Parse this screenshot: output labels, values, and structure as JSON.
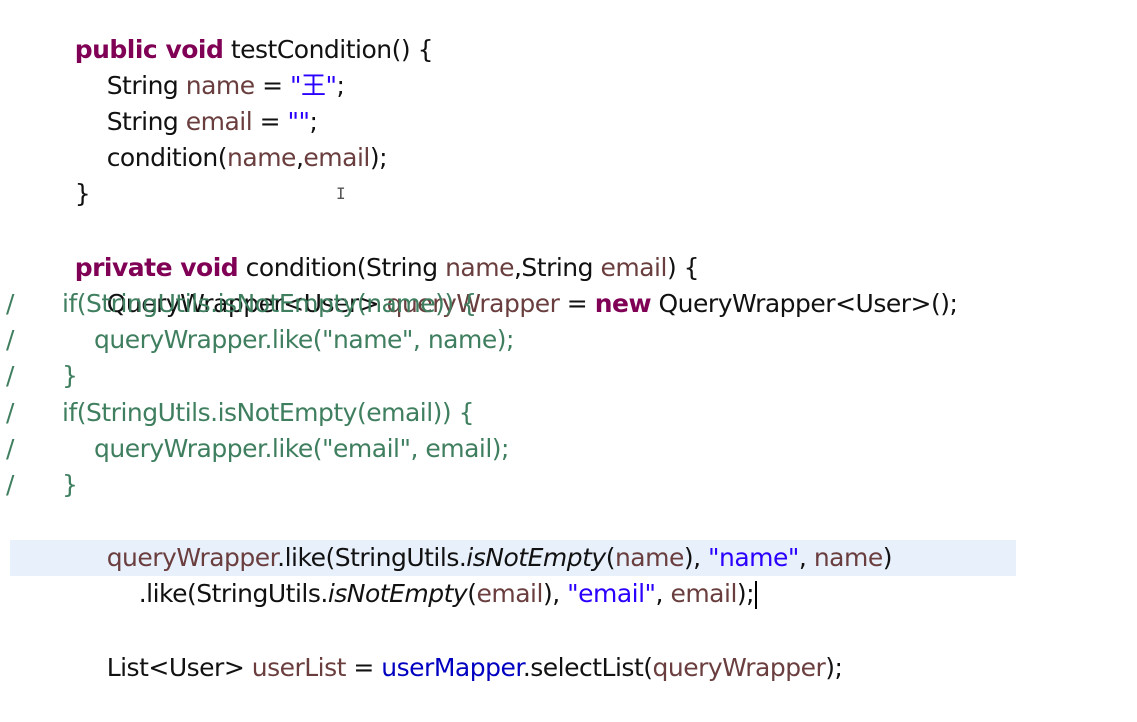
{
  "code": {
    "l1": {
      "kw": "public void",
      "rest": " testCondition() {"
    },
    "l2": {
      "type": "String",
      "var": "name",
      "eq": " = ",
      "str": "\"王\"",
      "end": ";"
    },
    "l3": {
      "type": "String",
      "var": "email",
      "eq": " = ",
      "str": "\"\"",
      "end": ";"
    },
    "l4": {
      "a": "condition(",
      "b": "name",
      "c": ",",
      "d": "email",
      "e": ");"
    },
    "l5": {
      "text": "}"
    },
    "l6": {
      "kw": "private void",
      "a": " condition(String ",
      "b": "name",
      "c": ",String ",
      "d": "email",
      "e": ") {"
    },
    "l7": {
      "a": "QueryWrapper<User> ",
      "b": "queryWrapper",
      "c": " = ",
      "kw": "new",
      "d": " QueryWrapper<User>();"
    },
    "l8": {
      "marker": "/",
      "text": "if(StringUtils.isNotEmpty(name)) {"
    },
    "l9": {
      "marker": "/",
      "text": "queryWrapper.like(\"name\", name);"
    },
    "l10": {
      "marker": "/",
      "text": "}"
    },
    "l11": {
      "marker": "/",
      "text": "if(StringUtils.isNotEmpty(email)) {"
    },
    "l12": {
      "marker": "/",
      "text": "queryWrapper.like(\"email\", email);"
    },
    "l13": {
      "marker": "/",
      "text": "}"
    },
    "l14": {
      "a": "queryWrapper",
      "b": ".like(StringUtils.",
      "c": "isNotEmpty",
      "d": "(",
      "e": "name",
      "f": "), ",
      "g": "\"name\"",
      "h": ", ",
      "i": "name",
      "j": ")"
    },
    "l15": {
      "a": ".like(StringUtils.",
      "b": "isNotEmpty",
      "c": "(",
      "d": "email",
      "e": "), ",
      "f": "\"email\"",
      "g": ", ",
      "h": "email",
      "i": ");"
    },
    "l16": {
      "a": "List<User> ",
      "b": "userList",
      "c": " = ",
      "d": "userMapper",
      "e": ".selectList(",
      "f": "queryWrapper",
      "g": ");"
    }
  },
  "cursor_icon": "i-beam-cursor-icon",
  "colors": {
    "keyword": "#7f0055",
    "string": "#2a00ff",
    "local_var": "#6a3e3e",
    "field": "#0000c0",
    "comment": "#3f7f5f",
    "current_line": "#e8f0fb"
  }
}
